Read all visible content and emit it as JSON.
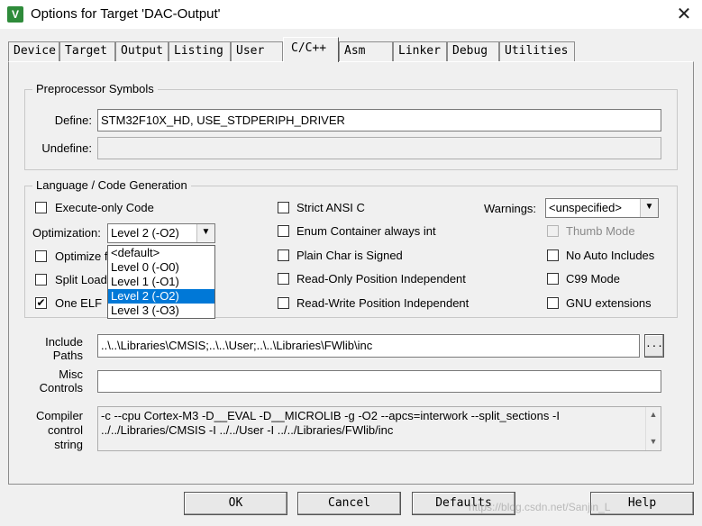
{
  "window": {
    "title": "Options for Target 'DAC-Output'",
    "icon_letter": "V"
  },
  "tabs": [
    "Device",
    "Target",
    "Output",
    "Listing",
    "User",
    "C/C++",
    "Asm",
    "Linker",
    "Debug",
    "Utilities"
  ],
  "active_tab": "C/C++",
  "preprocessor": {
    "group_label": "Preprocessor Symbols",
    "define_label": "Define:",
    "define_value": "STM32F10X_HD, USE_STDPERIPH_DRIVER",
    "undefine_label": "Undefine:",
    "undefine_value": ""
  },
  "codegen": {
    "group_label": "Language / Code Generation",
    "execute_only": {
      "label": "Execute-only Code",
      "checked": false
    },
    "optimization_label": "Optimization:",
    "optimization_value": "Level 2 (-O2)",
    "optimization_options": [
      "<default>",
      "Level 0 (-O0)",
      "Level 1 (-O1)",
      "Level 2 (-O2)",
      "Level 3 (-O3)"
    ],
    "optimize_time": {
      "label": "Optimize f",
      "checked": false
    },
    "split_load": {
      "label": "Split Load",
      "checked": false
    },
    "one_elf": {
      "label": "One ELF",
      "checked": true
    },
    "strict_ansi": {
      "label": "Strict ANSI C",
      "checked": false
    },
    "enum_container": {
      "label": "Enum Container always int",
      "checked": false
    },
    "plain_char": {
      "label": "Plain Char is Signed",
      "checked": false
    },
    "ro_pi": {
      "label": "Read-Only Position Independent",
      "checked": false
    },
    "rw_pi": {
      "label": "Read-Write Position Independent",
      "checked": false
    },
    "warnings_label": "Warnings:",
    "warnings_value": "<unspecified>",
    "thumb_mode": {
      "label": "Thumb Mode",
      "checked": false
    },
    "no_auto_includes": {
      "label": "No Auto Includes",
      "checked": false
    },
    "c99_mode": {
      "label": "C99 Mode",
      "checked": false
    },
    "gnu_ext": {
      "label": "GNU extensions",
      "checked": false
    }
  },
  "include": {
    "label_line1": "Include",
    "label_line2": "Paths",
    "value": "..\\..\\Libraries\\CMSIS;..\\..\\User;..\\..\\Libraries\\FWlib\\inc",
    "browse_label": "..."
  },
  "misc": {
    "label_line1": "Misc",
    "label_line2": "Controls",
    "value": ""
  },
  "compiler": {
    "label_line1": "Compiler",
    "label_line2": "control",
    "label_line3": "string",
    "line1": "-c --cpu Cortex-M3 -D__EVAL -D__MICROLIB -g -O2 --apcs=interwork --split_sections -I",
    "line2": "../../Libraries/CMSIS -I ../../User -I ../../Libraries/FWlib/inc"
  },
  "buttons": {
    "ok": "OK",
    "cancel": "Cancel",
    "defaults": "Defaults",
    "help": "Help"
  },
  "watermark": "https://blog.csdn.net/Sanjin_L"
}
